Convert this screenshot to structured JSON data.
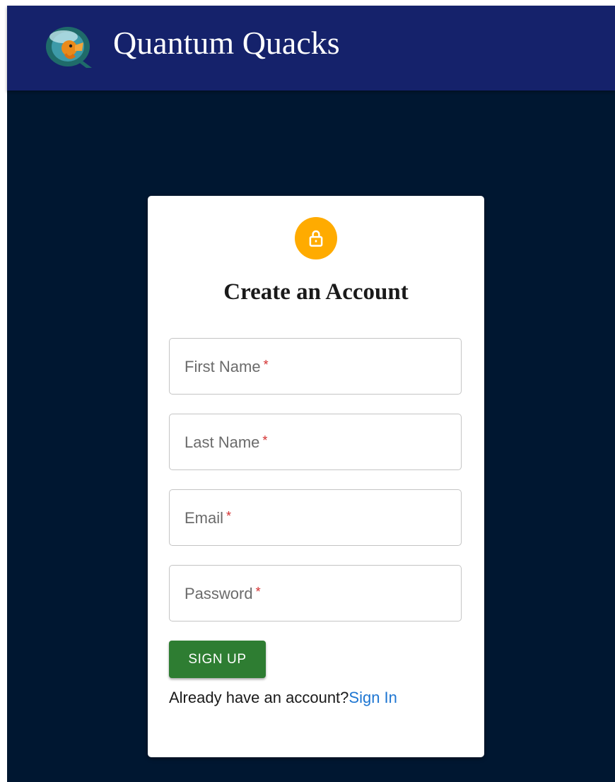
{
  "header": {
    "brand_name": "Quantum Quacks",
    "logo_icon": "quantum-quacks-duck-logo"
  },
  "signup_card": {
    "icon": "lock-icon",
    "accent_color": "#ffab00",
    "title": "Create an Account",
    "fields": [
      {
        "label": "First Name",
        "required_mark": "*",
        "value": ""
      },
      {
        "label": "Last Name",
        "required_mark": "*",
        "value": ""
      },
      {
        "label": "Email",
        "required_mark": "*",
        "value": ""
      },
      {
        "label": "Password",
        "required_mark": "*",
        "value": ""
      }
    ],
    "submit_label": "SIGN UP",
    "submit_color": "#2e7d32",
    "signin_prompt": "Already have an account?",
    "signin_link_label": "Sign In",
    "link_color": "#1e76d2"
  },
  "theme": {
    "header_bg": "#15226b",
    "page_bg": "#001731"
  }
}
